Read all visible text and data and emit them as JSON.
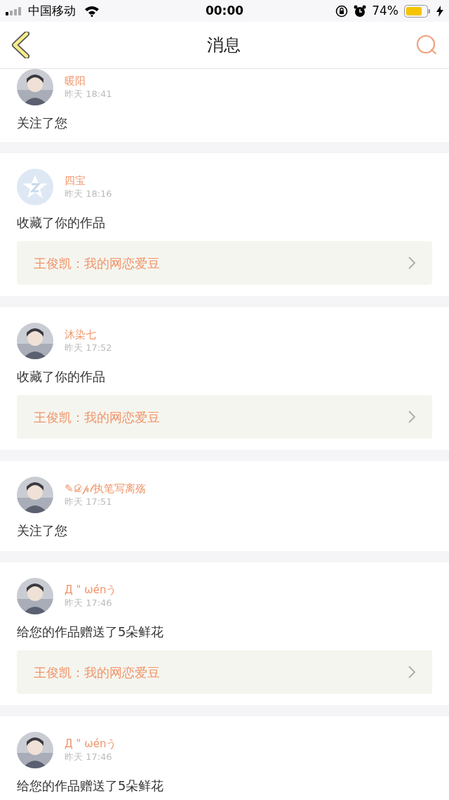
{
  "status_bar": {
    "carrier": "中国移动",
    "time": "00:00",
    "battery": "74%"
  },
  "header": {
    "title": "消息"
  },
  "messages": [
    {
      "name": "暖阳",
      "time": "昨天 18:41",
      "action": "关注了您"
    },
    {
      "kind": "default",
      "name": "四宝",
      "time": "昨天 18:16",
      "action": "收藏了你的作品",
      "work": "王俊凯：我的网恋爱豆"
    },
    {
      "name": "沐染七",
      "time": "昨天 17:52",
      "action": "收藏了你的作品",
      "work": "王俊凯：我的网恋爱豆"
    },
    {
      "name": "✎𝒟𝓅𝓁执笔写离殇",
      "time": "昨天 17:51",
      "action": "关注了您"
    },
    {
      "name": "Д \" ωénう",
      "time": "昨天 17:46",
      "action": "给您的作品赠送了5朵鲜花",
      "work": "王俊凯：我的网恋爱豆"
    },
    {
      "name": "Д \" ωénう",
      "time": "昨天 17:46",
      "action": "给您的作品赠送了5朵鲜花"
    }
  ]
}
